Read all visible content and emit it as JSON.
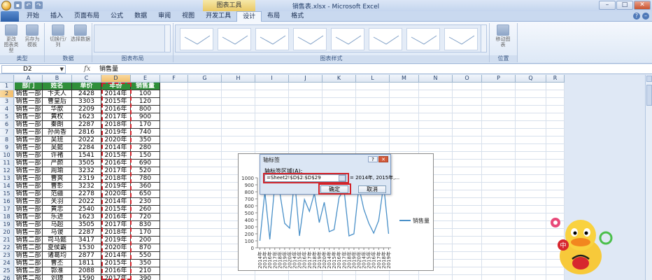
{
  "window": {
    "title": "销售表.xlsx - Microsoft Excel",
    "context_tab_group": "图表工具",
    "minimize": "–",
    "restore": "□",
    "close": "✕"
  },
  "ribbon_tabs": [
    "开始",
    "插入",
    "页面布局",
    "公式",
    "数据",
    "审阅",
    "视图",
    "开发工具",
    "设计",
    "布局",
    "格式"
  ],
  "active_tab_index": 8,
  "ribbon": {
    "groups": [
      {
        "label": "类型",
        "buttons": [
          [
            "更改",
            "图表类型"
          ],
          [
            "另存为",
            "模板"
          ]
        ]
      },
      {
        "label": "数据",
        "buttons": [
          [
            "切换行/列"
          ],
          [
            "选择数据"
          ]
        ]
      },
      {
        "label": "图表布局"
      },
      {
        "label": "图表样式"
      },
      {
        "label": "位置",
        "buttons": [
          [
            "移动图表"
          ]
        ]
      }
    ]
  },
  "formula_bar": {
    "name_box": "D2",
    "fx": "fx",
    "value": "销售量"
  },
  "grid": {
    "columns": [
      "A",
      "B",
      "C",
      "D",
      "E",
      "F",
      "G",
      "H",
      "I",
      "J",
      "K",
      "L",
      "M",
      "N",
      "O",
      "P",
      "Q",
      "R"
    ],
    "headers": [
      "部门",
      "姓名",
      "单价",
      "年份",
      "销售量"
    ],
    "rows": [
      [
        "销售一部",
        "卞夫人",
        "2428",
        "2014年",
        "100"
      ],
      [
        "销售一部",
        "曹皇后",
        "3303",
        "2015年",
        "120"
      ],
      [
        "销售一部",
        "华歆",
        "2209",
        "2016年",
        "800"
      ],
      [
        "销售一部",
        "黄权",
        "1623",
        "2017年",
        "900"
      ],
      [
        "销售一部",
        "秦朗",
        "2287",
        "2018年",
        "170"
      ],
      [
        "销售一部",
        "孙尚香",
        "2816",
        "2019年",
        "740"
      ],
      [
        "销售一部",
        "吴班",
        "2022",
        "2020年",
        "350"
      ],
      [
        "销售一部",
        "吴懿",
        "2284",
        "2014年",
        "280"
      ],
      [
        "销售一部",
        "许褚",
        "1541",
        "2015年",
        "150"
      ],
      [
        "销售一部",
        "严颜",
        "3505",
        "2016年",
        "690"
      ],
      [
        "销售一部",
        "周瑜",
        "3232",
        "2017年",
        "520"
      ],
      [
        "销售一部",
        "曹爽",
        "2319",
        "2018年",
        "780"
      ],
      [
        "销售一部",
        "曹彰",
        "3232",
        "2019年",
        "360"
      ],
      [
        "销售一部",
        "范疆",
        "2278",
        "2020年",
        "650"
      ],
      [
        "销售一部",
        "关羽",
        "2022",
        "2014年",
        "230"
      ],
      [
        "销售一部",
        "黄忠",
        "2540",
        "2015年",
        "260"
      ],
      [
        "销售一部",
        "乐进",
        "1623",
        "2016年",
        "720"
      ],
      [
        "销售一部",
        "马超",
        "3505",
        "2017年",
        "830"
      ],
      [
        "销售一部",
        "马谡",
        "2287",
        "2018年",
        "170"
      ],
      [
        "销售二部",
        "司马懿",
        "3417",
        "2019年",
        "200"
      ],
      [
        "销售二部",
        "夏侯霸",
        "1530",
        "2020年",
        "870"
      ],
      [
        "销售二部",
        "诸葛均",
        "2877",
        "2014年",
        "550"
      ],
      [
        "销售二部",
        "曹丕",
        "1811",
        "2015年",
        "350"
      ],
      [
        "销售二部",
        "郭淮",
        "2088",
        "2016年",
        "210"
      ],
      [
        "销售二部",
        "刘璋",
        "1590",
        "2017年",
        "390"
      ]
    ]
  },
  "chart": {
    "legend_label": "销售量",
    "y_ticks": [
      "1000",
      "900",
      "800",
      "700",
      "600",
      "500",
      "400",
      "300",
      "200",
      "100",
      "0"
    ],
    "x_labels": [
      "2014年",
      "2015年",
      "2016年",
      "2017年",
      "2018年",
      "2019年",
      "2020年",
      "2014年",
      "2015年",
      "2016年",
      "2017年",
      "2018年",
      "2019年",
      "2020年",
      "2014年",
      "2015年",
      "2016年",
      "2017年",
      "2018年",
      "2019年",
      "2020年",
      "2014年",
      "2015年",
      "2016年",
      "2017年",
      "2018年",
      "2019年"
    ]
  },
  "chart_data": {
    "type": "line",
    "ylim": [
      0,
      1000
    ],
    "series": [
      {
        "name": "销售量",
        "values": [
          100,
          800,
          120,
          900,
          800,
          350,
          280,
          980,
          170,
          690,
          520,
          780,
          360,
          650,
          230,
          260,
          720,
          830,
          170,
          200,
          870,
          550,
          350,
          210,
          390,
          900,
          200
        ]
      }
    ]
  },
  "dialog": {
    "title": "轴标签",
    "help": "?",
    "close": "✕",
    "range_label": "轴标签区域(A):",
    "range_value": "=Sheet2!$D$2:$D$29",
    "preview": "= 2014年, 2015年,...",
    "ok": "确定",
    "cancel": "取消"
  },
  "mascot": {
    "badge_text": "中"
  },
  "colors": {
    "header_green": "#2f8f3a",
    "accent_red": "#d2232a",
    "line_blue": "#4a90c8"
  }
}
